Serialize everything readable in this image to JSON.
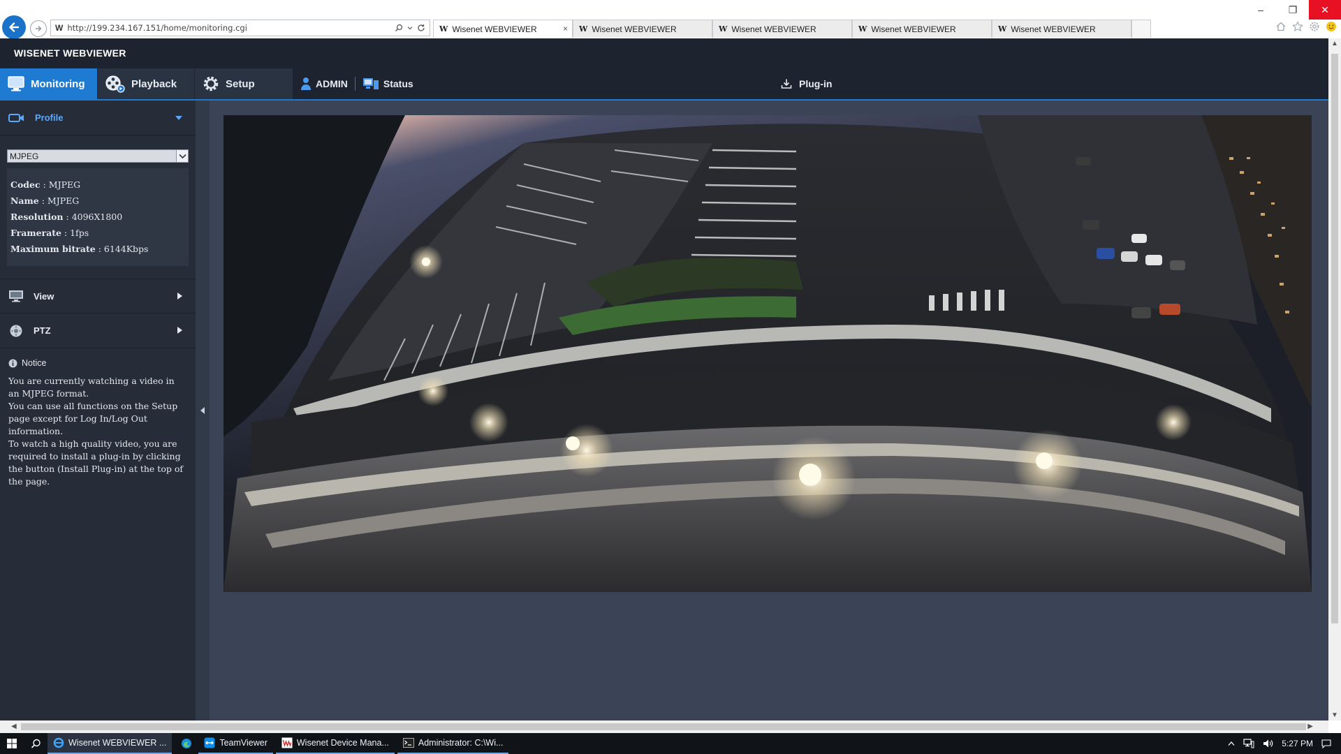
{
  "browser": {
    "url": "http://199.234.167.151/home/monitoring.cgi",
    "site_icon": "W",
    "tabs": [
      {
        "title": "Wisenet WEBVIEWER",
        "active": true,
        "close": "×"
      },
      {
        "title": "Wisenet WEBVIEWER",
        "active": false
      },
      {
        "title": "Wisenet WEBVIEWER",
        "active": false
      },
      {
        "title": "Wisenet WEBVIEWER",
        "active": false
      },
      {
        "title": "Wisenet WEBVIEWER",
        "active": false
      }
    ],
    "window_controls": {
      "minimize": "–",
      "restore": "❐",
      "close": "✕"
    }
  },
  "app": {
    "brand": "WISENET WEBVIEWER",
    "nav": {
      "monitoring": "Monitoring",
      "playback": "Playback",
      "setup": "Setup",
      "user": "ADMIN",
      "status": "Status",
      "plugin": "Plug-in"
    },
    "accent_color": "#1f7ad2"
  },
  "sidebar": {
    "profile_label": "Profile",
    "profile_selected": "MJPEG",
    "profile_info": [
      {
        "key": "Codec",
        "value": "MJPEG"
      },
      {
        "key": "Name",
        "value": "MJPEG"
      },
      {
        "key": "Resolution",
        "value": "4096X1800"
      },
      {
        "key": "Framerate",
        "value": "1fps"
      },
      {
        "key": "Maximum bitrate",
        "value": "6144Kbps"
      }
    ],
    "view_label": "View",
    "ptz_label": "PTZ",
    "notice_title": "Notice",
    "notice_lines": [
      "You are currently watching a video in an MJPEG format.",
      "You can use all functions on the Setup page except for Log In/Log Out information.",
      "To watch a high quality video, you are required to install a plug-in by clicking the button (Install Plug-in) at the top of the page."
    ]
  },
  "taskbar": {
    "items": [
      {
        "label": "Wisenet WEBVIEWER ...",
        "icon": "ie-icon",
        "active": true
      },
      {
        "label": "TeamViewer",
        "icon": "teamviewer-icon",
        "active": false
      },
      {
        "label": "Wisenet Device Mana...",
        "icon": "wisenet-icon",
        "active": false
      },
      {
        "label": "Administrator: C:\\Wi...",
        "icon": "cmd-icon",
        "active": false
      }
    ],
    "clock": "5:27 PM"
  }
}
